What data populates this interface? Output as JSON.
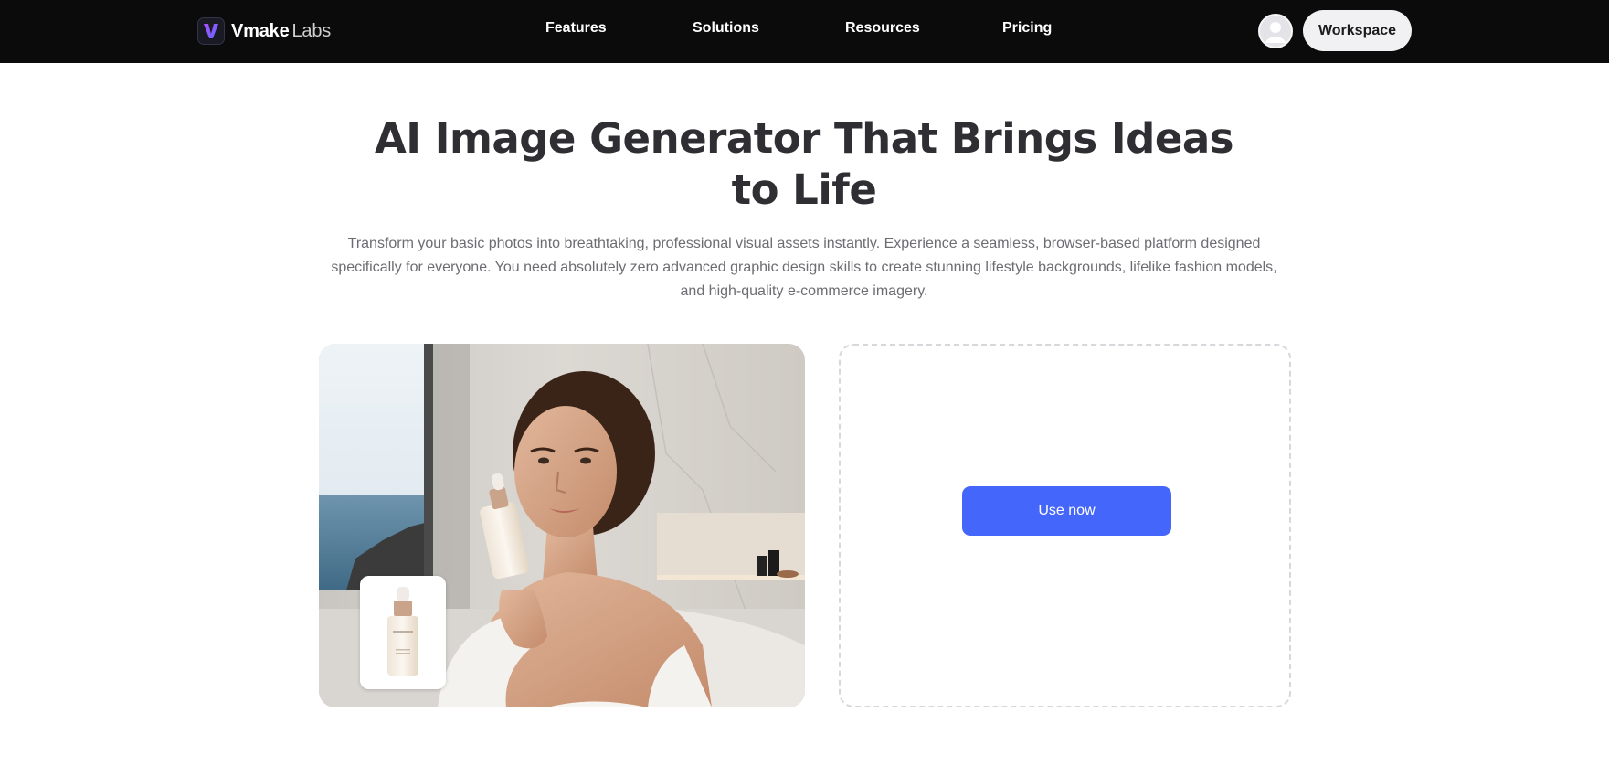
{
  "brand": {
    "name": "Vmake",
    "suffix": "Labs"
  },
  "nav": {
    "links": [
      "Features",
      "Solutions",
      "Resources",
      "Pricing"
    ],
    "workspace_label": "Workspace"
  },
  "hero": {
    "title_line1": "AI Image Generator That Brings Ideas",
    "title_line2": "to Life",
    "subtitle_line1": "Transform your basic photos into breathtaking, professional visual assets instantly. Experience a seamless, browser-based platform designed",
    "subtitle_line2": "specifically for everyone. You need absolutely zero advanced graphic design skills to create stunning lifestyle backgrounds, lifelike fashion models,",
    "subtitle_line3": "and high-quality e-commerce imagery."
  },
  "upload": {
    "button_label": "Use now"
  },
  "icons": {
    "logo": "vmake-logo-icon",
    "avatar": "user-avatar-icon"
  },
  "colors": {
    "nav_bg": "#0b0b0b",
    "accent": "#4566fa",
    "title": "#2f2f33",
    "subtitle": "#6c6c72"
  }
}
